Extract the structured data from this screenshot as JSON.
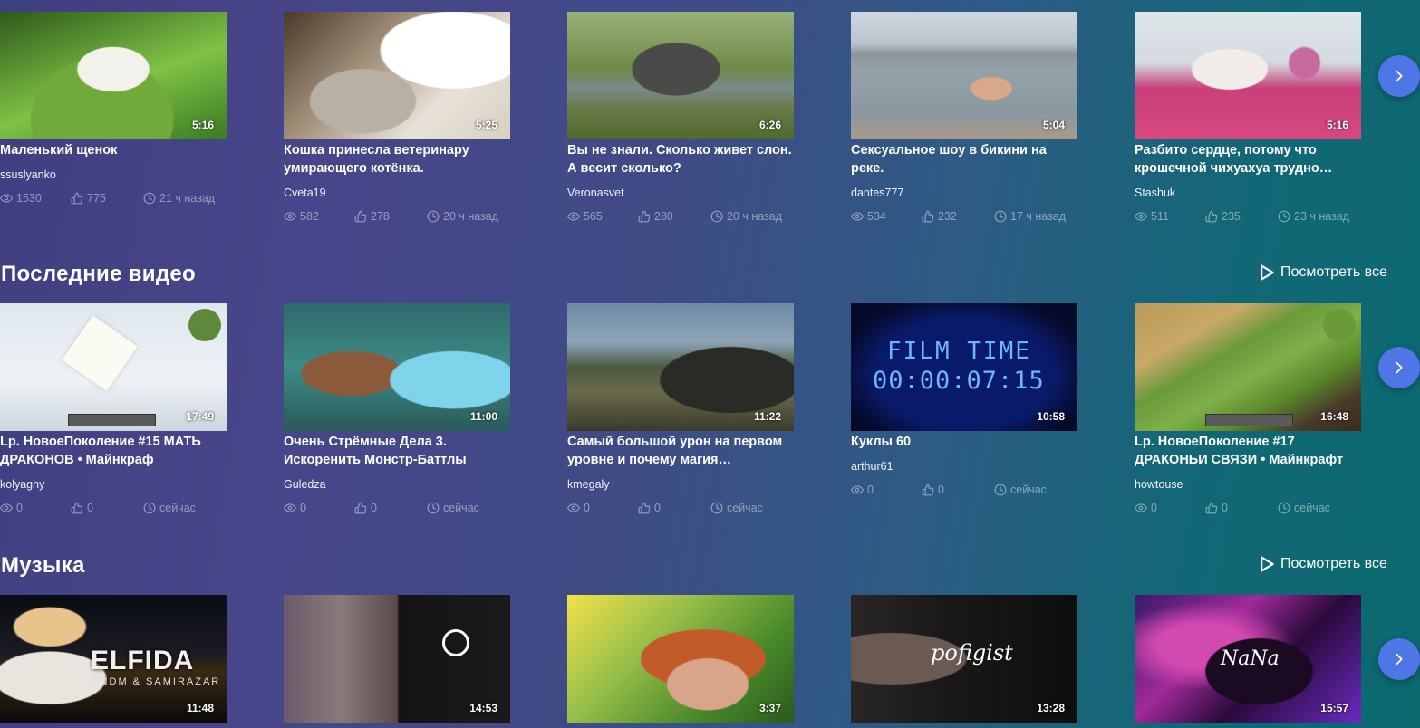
{
  "rows": [
    {
      "cards": [
        {
          "title": "Маленький щенок",
          "author": "ssuslyanko",
          "views": "1530",
          "likes": "775",
          "time": "21 ч назад",
          "duration": "5:16"
        },
        {
          "title": "Кошка принесла ветеринару умирающего котёнка.",
          "author": "Cveta19",
          "views": "582",
          "likes": "278",
          "time": "20 ч назад",
          "duration": "5:25"
        },
        {
          "title": "Вы не знали. Сколько живет слон. А весит сколько?",
          "author": "Veronasvet",
          "views": "565",
          "likes": "280",
          "time": "20 ч назад",
          "duration": "6:26"
        },
        {
          "title": "Сексуальное шоу в бикини на реке.",
          "author": "dantes777",
          "views": "534",
          "likes": "232",
          "time": "17 ч назад",
          "duration": "5:04"
        },
        {
          "title": "Разбито сердце, потому что крошечной чихуахуа трудно…",
          "author": "Stashuk",
          "views": "511",
          "likes": "235",
          "time": "23 ч назад",
          "duration": "5:16"
        }
      ]
    },
    {
      "title": "Последние видео",
      "see_all": "Посмотреть все",
      "cards": [
        {
          "title": "Lp. НовоеПоколение #15 МАТЬ ДРАКОНОВ • Майнкраф",
          "author": "kolyaghy",
          "views": "0",
          "likes": "0",
          "time": "сейчас",
          "duration": "17:49"
        },
        {
          "title": "Очень Стрёмные Дела 3. Искоренить Монстр-Баттлы",
          "author": "Guledza",
          "views": "0",
          "likes": "0",
          "time": "сейчас",
          "duration": "11:00"
        },
        {
          "title": "Самый большой урон на первом уровне и почему магия…",
          "author": "kmegaly",
          "views": "0",
          "likes": "0",
          "time": "сейчас",
          "duration": "11:22"
        },
        {
          "title": "Куклы 60",
          "author": "arthur61",
          "views": "0",
          "likes": "0",
          "time": "сейчас",
          "duration": "10:58",
          "thumb_text_1": "FILM TIME",
          "thumb_text_2": "00:00:07:15"
        },
        {
          "title": "Lp. НовоеПоколение #17 ДРАКОНЬИ СВЯЗИ • Майнкрафт",
          "author": "howtouse",
          "views": "0",
          "likes": "0",
          "time": "сейчас",
          "duration": "16:48"
        }
      ]
    },
    {
      "title": "Музыка",
      "see_all": "Посмотреть все",
      "cards": [
        {
          "duration": "11:48",
          "thumb_text_1": "ELFIDA",
          "thumb_text_2": "ONDM & SAMIRAZAR"
        },
        {
          "duration": "14:53"
        },
        {
          "duration": "3:37"
        },
        {
          "duration": "13:28",
          "thumb_text_1": "pofigist"
        },
        {
          "duration": "15:57",
          "thumb_text_1": "NaNa"
        }
      ]
    }
  ],
  "colors": {
    "accent": "#4e76e6",
    "muted": "rgba(255,255,255,0.45)"
  }
}
